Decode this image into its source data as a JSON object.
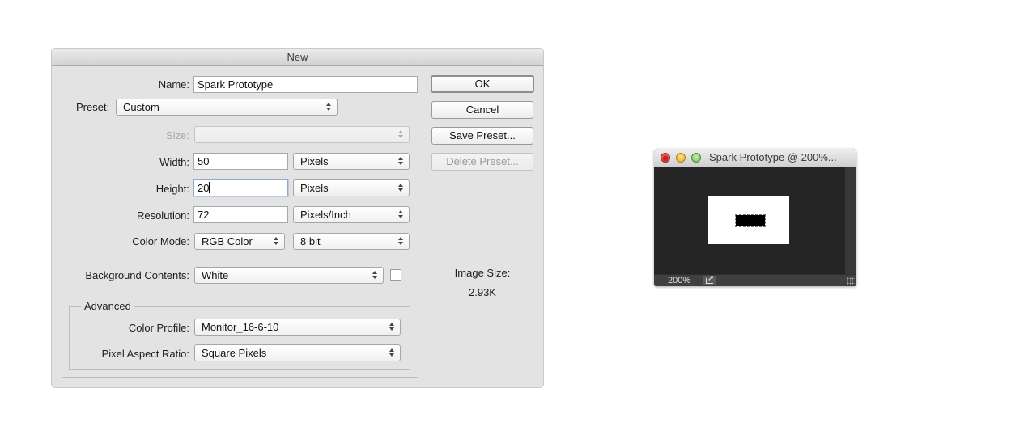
{
  "dialog": {
    "title": "New",
    "name_label": "Name:",
    "name_value": "Spark Prototype",
    "preset_label": "Preset:",
    "preset_value": "Custom",
    "size_label": "Size:",
    "size_value": "",
    "width_label": "Width:",
    "width_value": "50",
    "width_unit": "Pixels",
    "height_label": "Height:",
    "height_value": "20",
    "height_unit": "Pixels",
    "resolution_label": "Resolution:",
    "resolution_value": "72",
    "resolution_unit": "Pixels/Inch",
    "color_mode_label": "Color Mode:",
    "color_mode_value": "RGB Color",
    "bit_depth_value": "8 bit",
    "background_label": "Background Contents:",
    "background_value": "White",
    "background_swatch_color": "#ffffff",
    "advanced_label": "Advanced",
    "color_profile_label": "Color Profile:",
    "color_profile_value": "Monitor_16-6-10",
    "pixel_aspect_label": "Pixel Aspect Ratio:",
    "pixel_aspect_value": "Square Pixels",
    "buttons": {
      "ok": "OK",
      "cancel": "Cancel",
      "save_preset": "Save Preset...",
      "delete_preset": "Delete Preset..."
    },
    "image_size_label": "Image Size:",
    "image_size_value": "2.93K"
  },
  "document_window": {
    "title": "Spark Prototype @ 200%...",
    "zoom_level": "200%"
  }
}
